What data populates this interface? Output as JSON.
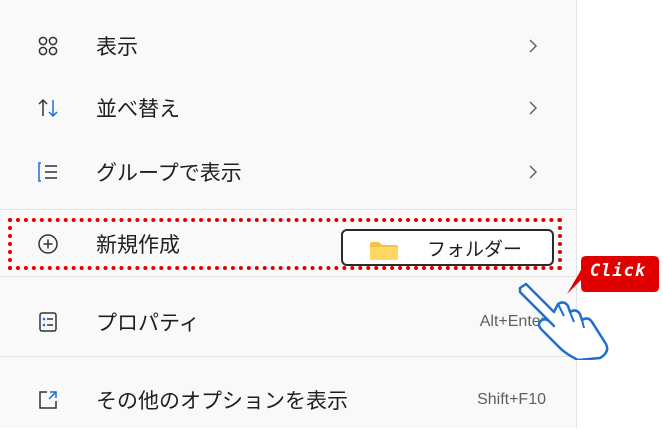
{
  "menu": {
    "items": [
      {
        "label": "表示",
        "icon": "view-grid-icon",
        "has_submenu": true
      },
      {
        "label": "並べ替え",
        "icon": "sort-arrows-icon",
        "has_submenu": true
      },
      {
        "label": "グループで表示",
        "icon": "group-list-icon",
        "has_submenu": true
      },
      {
        "label": "新規作成",
        "icon": "add-circle-icon",
        "has_submenu": false
      },
      {
        "label": "プロパティ",
        "icon": "properties-icon",
        "shortcut": "Alt+Enter"
      },
      {
        "label": "その他のオプションを表示",
        "icon": "more-options-icon",
        "shortcut": "Shift+F10"
      }
    ]
  },
  "submenu": {
    "items": [
      {
        "label": "フォルダー",
        "icon": "folder-icon"
      }
    ]
  },
  "callout": {
    "text": "Click",
    "color": "#e00000"
  },
  "colors": {
    "highlight_border": "#e00000",
    "menu_background": "#f9f9f9",
    "folder": "#f3c246"
  }
}
